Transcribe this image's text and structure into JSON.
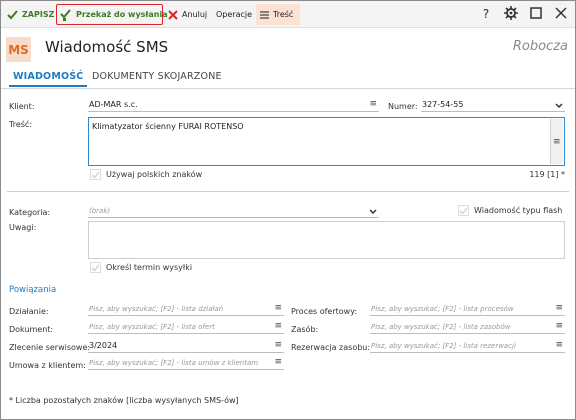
{
  "toolbar": {
    "save_label": "ZAPISZ",
    "send_label": "Przekaż do wysłania",
    "cancel_label": "Anuluj",
    "operations_label": "Operacje",
    "content_label": "Treść",
    "help_glyph": "?"
  },
  "header": {
    "icon_text": "MS",
    "title": "Wiadomość SMS",
    "status": "Robocza"
  },
  "tabs": {
    "message": "WIADOMOŚĆ",
    "linked_docs": "DOKUMENTY SKOJARZONE",
    "active": "message"
  },
  "form": {
    "client_label": "Klient:",
    "client_value": "AD-MAR s.c.",
    "number_label": "Numer:",
    "number_value": "327-54-55",
    "content_label": "Treść:",
    "content_value": "Klimatyzator ścienny FURAI ROTENSO",
    "polish_chars_label": "Używaj polskich znaków",
    "polish_chars_checked": true,
    "counter": "119 [1] *",
    "category_label": "Kategoria:",
    "category_placeholder": "(brak)",
    "flash_label": "Wiadomość typu flash",
    "flash_checked": true,
    "notes_label": "Uwagi:",
    "schedule_label": "Określ termin wysyłki",
    "schedule_checked": true
  },
  "links": {
    "section_title": "Powiązania",
    "action_label": "Działanie:",
    "action_placeholder": "Pisz, aby wyszukać; [F2] - lista działań",
    "document_label": "Dokument:",
    "document_placeholder": "Pisz, aby wyszukać; [F2] - lista ofert",
    "service_order_label": "Zlecenie serwisowe:",
    "service_order_value": "3/2024",
    "contract_label": "Umowa z klientem:",
    "contract_placeholder": "Pisz, aby wyszukać; [F2] - lista umów z klientam",
    "offer_process_label": "Proces ofertowy:",
    "offer_process_placeholder": "Pisz, aby wyszukać; [F2] - lista procesów",
    "resource_label": "Zasób:",
    "resource_placeholder": "Pisz, aby wyszukać; [F2] - lista zasobów",
    "reservation_label": "Rezerwacja zasobu:",
    "reservation_placeholder": "Pisz, aby wyszukać; [F2] - lista rezerwacji"
  },
  "footnote": "* Liczba pozostałych znaków [liczba wysyłanych SMS-ów]",
  "icons": {
    "save": "check-icon",
    "send": "send-check-icon",
    "cancel": "x-icon",
    "content": "list-icon",
    "help": "question-icon",
    "settings": "gear-icon",
    "maximize": "square-icon",
    "close": "close-icon",
    "lookup": "list-icon",
    "dropdown": "chevron-down-icon"
  },
  "colors": {
    "accent_blue": "#1f7cc1",
    "save_green": "#3f7a25",
    "cancel_red": "#d9262a",
    "brand_orange": "#e56b1f",
    "tab_highlight": "#fbe2d3"
  }
}
